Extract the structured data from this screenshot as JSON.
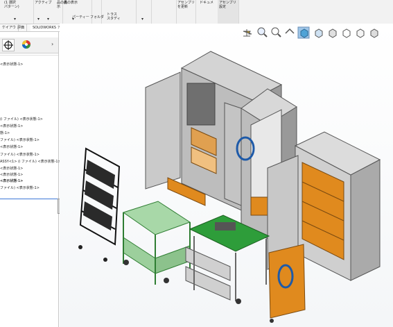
{
  "ribbon": {
    "groups": [
      {
        "label": "(1 選択\nパターン)"
      },
      {
        "label": "アクティブ"
      },
      {
        "label": "品の表示"
      },
      {
        "label": "品の表\n示"
      },
      {
        "label": "パーティー"
      },
      {
        "label": "フォルダ"
      },
      {
        "label": "トラス\nスタディ"
      },
      {
        "label": "アセンブリ\nを更新"
      },
      {
        "label": "ドキュメ"
      },
      {
        "label": "アセンブリ\n設定"
      }
    ]
  },
  "tabs": [
    "ケイアウ",
    "評価",
    "SOLIDWORKS アドイン"
  ],
  "panel": {
    "tree": [
      "<表示状態-1>",
      "(i ファイル) <表示状態-1>",
      "<表示状態-1>",
      "態-1>",
      "ファイル) <表示状態-1>",
      "<表示状態-1>",
      "ファイル) <表示状態-1>",
      "ASSY<1> (i ファイル) <表示状態-1>",
      "<表示状態-1>",
      "<表示状態-1>",
      "<表示状態-1>",
      "ファイル) <表示状態-1>",
      "<表示状態-1>"
    ]
  },
  "colors": {
    "accent": "#2e7d32",
    "orange": "#e08a1e",
    "cabinet": "#c8c8c8"
  }
}
